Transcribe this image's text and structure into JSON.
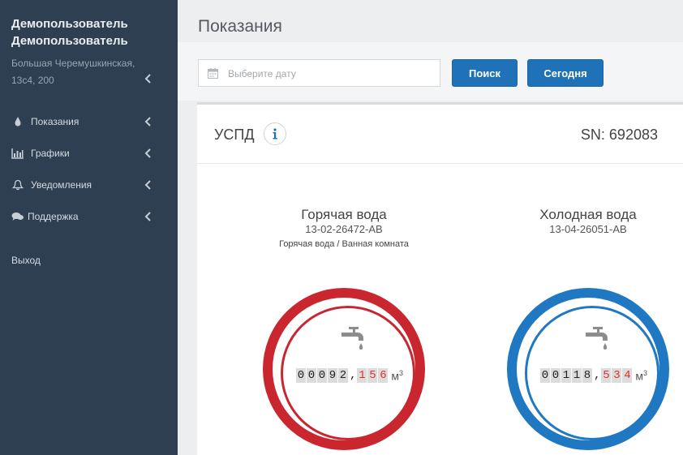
{
  "sidebar": {
    "user": {
      "first": "Демопользователь",
      "last": "Демопользователь"
    },
    "address": "Большая Черемушкинская, 13с4, 200",
    "items": [
      {
        "label": "Показания",
        "icon": "drop-icon"
      },
      {
        "label": "Графики",
        "icon": "bar-chart-icon"
      },
      {
        "label": "Уведомления",
        "icon": "bell-icon"
      },
      {
        "label": "Поддержка",
        "icon": "chat-icon"
      }
    ],
    "logout": "Выход"
  },
  "header": {
    "title": "Показания"
  },
  "toolbar": {
    "date_placeholder": "Выберите дату",
    "search_label": "Поиск",
    "today_label": "Сегодня"
  },
  "device": {
    "name": "УСПД",
    "sn_label": "SN:",
    "sn": "692083"
  },
  "meters": [
    {
      "title": "Горячая вода",
      "serial": "13-02-26472-AB",
      "location": "Горячая вода / Ванная комната",
      "integer_digits": [
        "0",
        "0",
        "0",
        "9",
        "2"
      ],
      "decimal_digits": [
        "1",
        "5",
        "6"
      ],
      "unit": "м",
      "unit_power": "3",
      "color": "#c9262f"
    },
    {
      "title": "Холодная вода",
      "serial": "13-04-26051-AB",
      "integer_digits": [
        "0",
        "0",
        "1",
        "1",
        "8"
      ],
      "decimal_digits": [
        "5",
        "3",
        "4"
      ],
      "unit": "м",
      "unit_power": "3",
      "color": "#1f78c1"
    }
  ]
}
